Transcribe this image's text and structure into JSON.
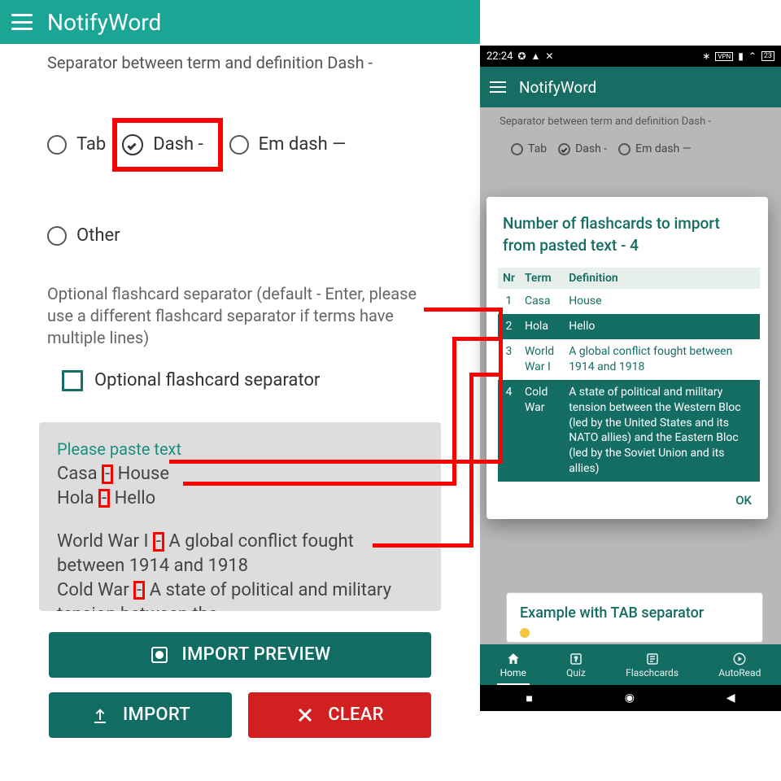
{
  "app": {
    "title": "NotifyWord"
  },
  "left": {
    "separator_label": "Separator between term and definition Dash -",
    "opts": {
      "tab": "Tab",
      "dash": "Dash -",
      "em": "Em dash —",
      "other": "Other"
    },
    "flashcard_sep_help": "Optional flashcard separator (default - Enter, please use a different flashcard separator if terms have multiple lines)",
    "flashcard_sep_chk": "Optional flashcard separator",
    "paste_title": "Please paste text",
    "paste_lines": {
      "l1a": "Casa",
      "l1b": "House",
      "l2a": "Hola",
      "l2b": "Hello",
      "l3a": "World War I",
      "l3b": "A global conflict fought between 1914 and 1918",
      "l4a": "Cold War",
      "l4b": "A state of political and military tension between the"
    },
    "buttons": {
      "preview": "IMPORT PREVIEW",
      "import": "IMPORT",
      "clear": "CLEAR"
    }
  },
  "phone": {
    "status": {
      "time": "22:24",
      "battery": "23"
    },
    "separator_label": "Separator between term and definition Dash -",
    "opts": {
      "tab": "Tab",
      "dash": "Dash -",
      "em": "Em dash —"
    },
    "dialog": {
      "title": "Number of flashcards to import from pasted text - 4",
      "headers": {
        "nr": "Nr",
        "term": "Term",
        "def": "Definition"
      },
      "rows": [
        {
          "nr": "1",
          "term": "Casa",
          "def": "House"
        },
        {
          "nr": "2",
          "term": "Hola",
          "def": "Hello"
        },
        {
          "nr": "3",
          "term": "World War I",
          "def": "A global conflict fought between 1914 and 1918"
        },
        {
          "nr": "4",
          "term": "Cold War",
          "def": "A state of political and military tension between the Western Bloc (led by the United States and its NATO allies) and the Eastern Bloc (led by the Soviet Union and its allies)"
        }
      ],
      "ok": "OK"
    },
    "example_card": "Example with TAB separator",
    "nav": {
      "home": "Home",
      "quiz": "Quiz",
      "cards": "Flaschcards",
      "auto": "AutoRead"
    }
  }
}
